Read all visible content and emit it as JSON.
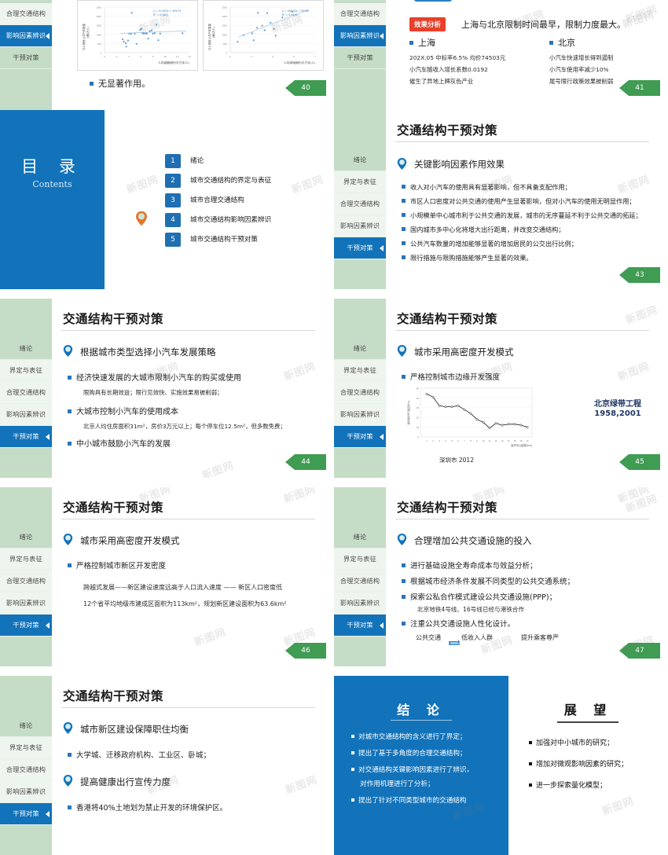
{
  "meta": {
    "doc_type": "slide-deck-thumbnail-grid",
    "watermark": "新图网",
    "accent_blue": "#1273ba",
    "accent_green_sidebar": "#c5ddc6",
    "page_badge_green": "#3f9c52",
    "red_tag": "#e8402a"
  },
  "nav": {
    "items": [
      "绪论",
      "界定与表征",
      "合理交通结构",
      "影响因素辨识",
      "干预对策"
    ]
  },
  "slides": [
    {
      "id": "slide-40",
      "page": "40",
      "active_nav": "影响因素辨识",
      "visible_nav": [
        "合理交通结构",
        "影响因素辨识",
        "干预对策"
      ],
      "bullets": [
        "无显著作用。"
      ],
      "charts": [
        {
          "type": "scatter",
          "ylabel": "万人拥有公共汽车数量（辆/万人）",
          "xlabel": "人均道路面积(平方米/人)",
          "equation": "y = 10.943x + 929.33",
          "r2": "R² = 0.0807",
          "xticks": [
            0,
            2,
            4,
            6,
            8,
            10,
            12,
            14
          ],
          "yticks": [
            0,
            500,
            1000,
            1500,
            2000,
            2500
          ],
          "points": [
            [
              3.0,
              730
            ],
            [
              3.2,
              600
            ],
            [
              3.5,
              520
            ],
            [
              3.6,
              330
            ],
            [
              3.9,
              700
            ],
            [
              4.1,
              1090
            ],
            [
              4.4,
              1080
            ],
            [
              4.5,
              2190
            ],
            [
              5.0,
              1140
            ],
            [
              5.3,
              570
            ],
            [
              5.9,
              1280
            ],
            [
              6.1,
              1340
            ],
            [
              6.3,
              1100
            ],
            [
              6.5,
              1090
            ],
            [
              6.8,
              1100
            ],
            [
              7.0,
              1090
            ],
            [
              7.2,
              780
            ],
            [
              7.5,
              1180
            ],
            [
              7.8,
              1220
            ],
            [
              8.0,
              1080
            ],
            [
              8.3,
              1100
            ],
            [
              8.6,
              1550
            ],
            [
              8.9,
              700
            ],
            [
              9.2,
              1090
            ],
            [
              12.9,
              1110
            ]
          ],
          "trend": {
            "slope": 10.943,
            "intercept": 929.33
          }
        },
        {
          "type": "scatter",
          "ylabel": "万人拥有公共汽车数量（辆/万人）",
          "xlabel": "人均绿地面积(平方米/人)",
          "equation": "y = 448.02x - 750.89",
          "r2": "R² = 0.5434",
          "xticks": [
            3,
            4,
            5,
            6,
            7
          ],
          "yticks": [
            0,
            500,
            1000,
            1500,
            2000,
            2500
          ],
          "points": [
            [
              3.35,
              600
            ],
            [
              3.7,
              960
            ],
            [
              4.2,
              1060
            ],
            [
              4.3,
              680
            ],
            [
              4.5,
              1360
            ],
            [
              4.55,
              2180
            ],
            [
              4.8,
              1480
            ],
            [
              4.95,
              1230
            ],
            [
              5.1,
              2170
            ],
            [
              5.3,
              1640
            ],
            [
              5.5,
              1300
            ],
            [
              5.6,
              930
            ],
            [
              6.0,
              1930
            ],
            [
              6.6,
              2250
            ]
          ],
          "trend": {
            "slope": 448.02,
            "intercept": -750.89
          }
        }
      ]
    },
    {
      "id": "slide-41",
      "page": "41",
      "active_nav": "影响因素辨识",
      "visible_nav": [
        "合理交通结构",
        "影响因素辨识",
        "干预对策"
      ],
      "tag": "效果分析",
      "headline": "上海与北京限制时间最早，限制力度最大。",
      "columns": [
        {
          "head": "上海",
          "lines": [
            "202X.05 中标率6.5% 均价74503元",
            "小汽车随收入增长系数0.0192",
            "催生了异地上牌灰色产业"
          ]
        },
        {
          "head": "北京",
          "lines": [
            "小汽车快速增长得到遏制",
            "小汽车使用率减少10%",
            "尾号限行政策效果被削弱"
          ]
        }
      ]
    },
    {
      "id": "slide-contents",
      "title_cn": "目 录",
      "title_en": "Contents",
      "items": [
        {
          "num": "1",
          "label": "绪论"
        },
        {
          "num": "2",
          "label": "城市交通结构的界定与表征"
        },
        {
          "num": "3",
          "label": "城市合理交通结构"
        },
        {
          "num": "4",
          "label": "城市交通结构影响因素辨识"
        },
        {
          "num": "5",
          "label": "城市交通结构干预对策"
        }
      ],
      "marker_at_item": 4
    },
    {
      "id": "slide-43",
      "page": "43",
      "title": "交通结构干预对策",
      "active_nav": "干预对策",
      "heading": "关键影响因素作用效果",
      "bullets": [
        "收入对小汽车的使用具有显著影响，但不具备支配作用；",
        "市区人口密度对公共交通的使用产生显著影响，但对小汽车的使用无明显作用；",
        "小规模单中心城市利于公共交通的发展，城市的无序蔓延不利于公共交通的拓延；",
        "国内城市多中心化将增大出行距离，并改变交通结构；",
        "公共汽车数量的增加能够显著的增加居民的公交出行比例；",
        "限行措施与限购措施能够产生显著的效果。"
      ]
    },
    {
      "id": "slide-44",
      "page": "44",
      "title": "交通结构干预对策",
      "active_nav": "干预对策",
      "heading": "根据城市类型选择小汽车发展策略",
      "blocks": [
        {
          "bullet": "经济快速发展的大城市限制小汽车的购买或使用",
          "note": "限购具有长期效益；限行见效快、实施效果易被削弱；"
        },
        {
          "bullet": "大城市控制小汽车的使用成本",
          "note": "北京人均住房面积31m²，房价3万元以上；每个停车位12.5m²，但多数免费；"
        },
        {
          "bullet": "中小城市鼓励小汽车的发展",
          "note": ""
        }
      ]
    },
    {
      "id": "slide-45",
      "page": "45",
      "title": "交通结构干预对策",
      "active_nav": "干预对策",
      "heading": "城市采用高密度开发模式",
      "bullets": [
        "严格控制城市边缘开发强度"
      ],
      "chart_caption": "深圳市 2012",
      "side_note_line1": "北京绿带工程",
      "side_note_line2": "1958,2001",
      "chart": {
        "type": "line",
        "title": "深圳市 2012",
        "xlabel": "距市中心距离(km)",
        "ylabel": "建筑容积率与覆盖率(%)",
        "xticks": [
          1,
          2,
          3,
          4,
          5,
          6,
          7,
          8,
          9,
          10,
          11,
          12,
          13,
          14,
          15,
          16,
          17
        ],
        "yticks": [
          0,
          10,
          20,
          30,
          40,
          50
        ],
        "values": [
          44,
          41,
          32,
          31,
          31,
          32,
          28,
          24,
          18,
          15,
          9,
          14,
          12,
          13,
          13,
          12,
          10
        ]
      }
    },
    {
      "id": "slide-46",
      "page": "46",
      "title": "交通结构干预对策",
      "active_nav": "干预对策",
      "heading": "城市采用高密度开发模式",
      "bullets": [
        "严格控制城市新区开发密度"
      ],
      "notes": [
        "跨越式发展——新区建设速度远高于人口流入速度 —— 新区人口密度低",
        "12个省平均地级市建成区面积为113km²，规划新区建设面积为63.6km²"
      ]
    },
    {
      "id": "slide-47",
      "page": "47",
      "title": "交通结构干预对策",
      "active_nav": "干预对策",
      "heading": "合理增加公共交通设施的投入",
      "bullets": [
        "进行基础设施全寿命成本与效益分析；",
        "根据城市经济条件发展不同类型的公共交通系统；",
        "探索公私合作模式建设公共交通设施(PPP)；",
        "注重公共交通设施人性化设计。"
      ],
      "notes": [
        "北京地铁4号线、16号线已经与港铁合作"
      ],
      "footer_left": "公共交通",
      "footer_mid": "低收入人群",
      "footer_right": "提升乘客尊严"
    },
    {
      "id": "slide-48",
      "title": "交通结构干预对策",
      "active_nav": "干预对策",
      "headings": [
        "城市新区建设保障职住均衡",
        "提高健康出行宣传力度"
      ],
      "bullets": [
        "大学城、迁移政府机构、工业区、卧城；",
        "香港将40%土地划为禁止开发的环境保护区。"
      ]
    },
    {
      "id": "slide-conclusion",
      "conclusion_title": "结 论",
      "conclusion_items": [
        "对城市交通结构的含义进行了界定；",
        "提出了基于多角度的合理交通结构；",
        "对交通结构关键影响因素进行了辨识，",
        "对作用机理进行了分析；",
        "提出了针对不同类型城市的交通结构"
      ],
      "outlook_title": "展 望",
      "outlook_items": [
        "加强对中小城市的研究；",
        "增加对微观影响因素的研究；",
        "进一步探索量化模型；"
      ]
    }
  ]
}
